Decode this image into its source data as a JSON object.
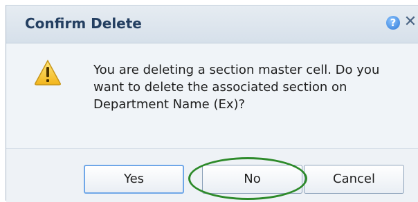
{
  "dialog": {
    "title": "Confirm Delete",
    "help_icon_glyph": "?",
    "close_icon_glyph": "✕",
    "message": "You are deleting a section master cell. Do you want to delete the associated section on Department Name (Ex)?",
    "warning_icon": "warning-triangle-icon",
    "icon_colors": {
      "warning_fill": "#f7c82b",
      "warning_outline": "#c8961a",
      "help_blue": "#2d78d6"
    }
  },
  "buttons": {
    "yes_label": "Yes",
    "no_label": "No",
    "cancel_label": "Cancel"
  },
  "annotation": {
    "highlight_color": "#2d8a2a"
  }
}
